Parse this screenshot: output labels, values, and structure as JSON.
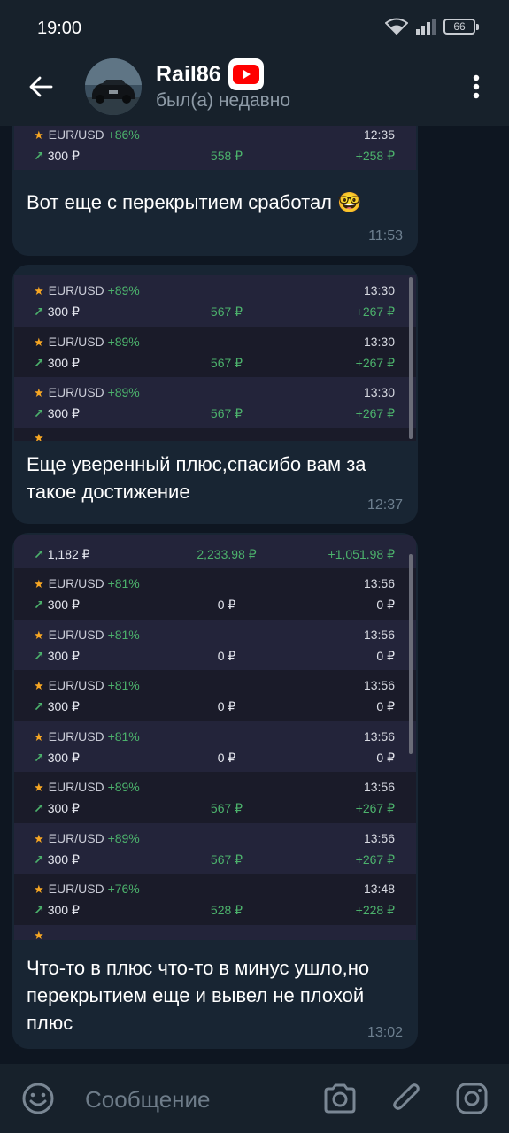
{
  "status_bar": {
    "time": "19:00",
    "battery": "66"
  },
  "header": {
    "name": "Rail86",
    "status": "был(а) недавно"
  },
  "messages": [
    {
      "trades_top_partial": {
        "pair": "EUR/USD",
        "pct": "+86%",
        "time": "12:35",
        "amount": "300 ₽",
        "payout": "558 ₽",
        "profit": "+258 ₽"
      },
      "text": "Вот еще с перекрытием сработал 🤓",
      "time": "11:53"
    },
    {
      "trades": [
        {
          "pair": "EUR/USD",
          "pct": "+89%",
          "time": "13:30",
          "amount": "300 ₽",
          "payout": "567 ₽",
          "profit": "+267 ₽"
        },
        {
          "pair": "EUR/USD",
          "pct": "+89%",
          "time": "13:30",
          "amount": "300 ₽",
          "payout": "567 ₽",
          "profit": "+267 ₽"
        },
        {
          "pair": "EUR/USD",
          "pct": "+89%",
          "time": "13:30",
          "amount": "300 ₽",
          "payout": "567 ₽",
          "profit": "+267 ₽"
        }
      ],
      "text": "Еще уверенный плюс,спасибо вам за такое достижение",
      "time": "12:37"
    },
    {
      "trade_first_partial": {
        "amount": "1,182 ₽",
        "payout": "2,233.98 ₽",
        "profit": "+1,051.98 ₽"
      },
      "trades": [
        {
          "pair": "EUR/USD",
          "pct": "+81%",
          "time": "13:56",
          "amount": "300 ₽",
          "payout": "0 ₽",
          "profit": "0 ₽"
        },
        {
          "pair": "EUR/USD",
          "pct": "+81%",
          "time": "13:56",
          "amount": "300 ₽",
          "payout": "0 ₽",
          "profit": "0 ₽"
        },
        {
          "pair": "EUR/USD",
          "pct": "+81%",
          "time": "13:56",
          "amount": "300 ₽",
          "payout": "0 ₽",
          "profit": "0 ₽"
        },
        {
          "pair": "EUR/USD",
          "pct": "+81%",
          "time": "13:56",
          "amount": "300 ₽",
          "payout": "0 ₽",
          "profit": "0 ₽"
        },
        {
          "pair": "EUR/USD",
          "pct": "+89%",
          "time": "13:56",
          "amount": "300 ₽",
          "payout": "567 ₽",
          "profit": "+267 ₽"
        },
        {
          "pair": "EUR/USD",
          "pct": "+89%",
          "time": "13:56",
          "amount": "300 ₽",
          "payout": "567 ₽",
          "profit": "+267 ₽"
        },
        {
          "pair": "EUR/USD",
          "pct": "+76%",
          "time": "13:48",
          "amount": "300 ₽",
          "payout": "528 ₽",
          "profit": "+228 ₽"
        }
      ],
      "text": "Что-то в плюс что-то в минус ушло,но перекрытием еще и вывел не плохой плюс",
      "time": "13:02"
    }
  ],
  "input": {
    "placeholder": "Сообщение"
  },
  "colors": {
    "background": "#0e1621",
    "bar": "#17212b",
    "bubble": "#182533",
    "accent_green": "#4cb26c",
    "star": "#f6a623"
  },
  "icons": [
    "back-arrow-icon",
    "youtube-icon",
    "more-vertical-icon",
    "emoji-icon",
    "camera-icon",
    "paperclip-icon",
    "instagram-icon",
    "wifi-icon",
    "signal-icon",
    "battery-icon",
    "star-icon",
    "trend-up-icon"
  ]
}
